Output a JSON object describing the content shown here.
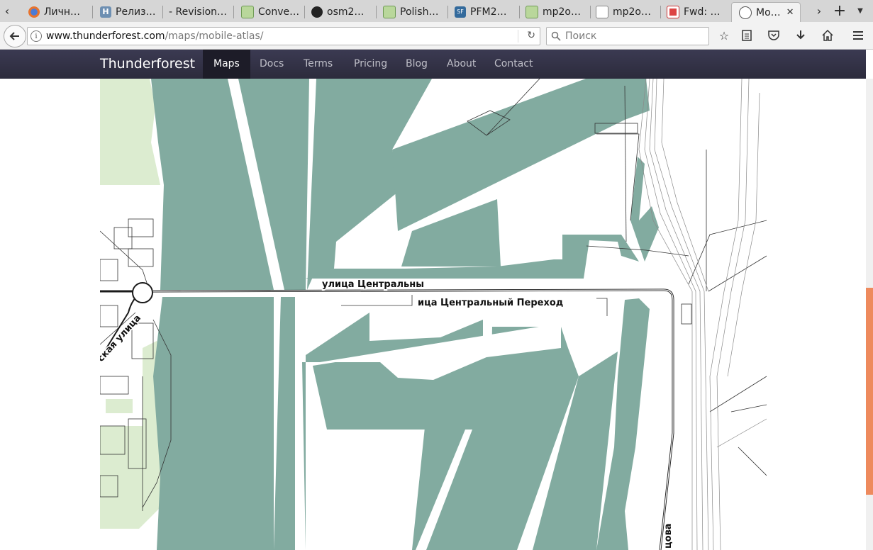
{
  "browser": {
    "tabs": [
      {
        "title": "Личн…",
        "icon": "firefox-account-icon"
      },
      {
        "title": "Релиз…",
        "icon": "habr-icon"
      },
      {
        "title": "- Revision…",
        "icon": "blank-page-icon"
      },
      {
        "title": "Conve…",
        "icon": "map-icon"
      },
      {
        "title": "osm2…",
        "icon": "github-icon"
      },
      {
        "title": "Polish…",
        "icon": "map-icon"
      },
      {
        "title": "PFM2…",
        "icon": "sourceforge-icon"
      },
      {
        "title": "mp2o…",
        "icon": "map-icon"
      },
      {
        "title": "mp2o…",
        "icon": "document-icon"
      },
      {
        "title": "Fwd: …",
        "icon": "gmail-icon"
      },
      {
        "title": "Mo…",
        "icon": "thunderforest-icon",
        "active": true
      }
    ],
    "url": {
      "host": "www.thunderforest.com",
      "path": "/maps/mobile-atlas/"
    },
    "search_placeholder": "Поиск"
  },
  "site": {
    "brand": "Thunderforest",
    "nav": [
      "Maps",
      "Docs",
      "Terms",
      "Pricing",
      "Blog",
      "About",
      "Contact"
    ],
    "active_nav": "Maps"
  },
  "map": {
    "labels": {
      "street_1": "улица Центральны",
      "street_2": "ица Центральный Переход",
      "street_3": "ская улица",
      "street_4": "цова"
    },
    "colors": {
      "water": "#82aba0",
      "park": "#dcecd0",
      "road": "#1a1a1a",
      "rail": "#8a8a8a"
    }
  }
}
